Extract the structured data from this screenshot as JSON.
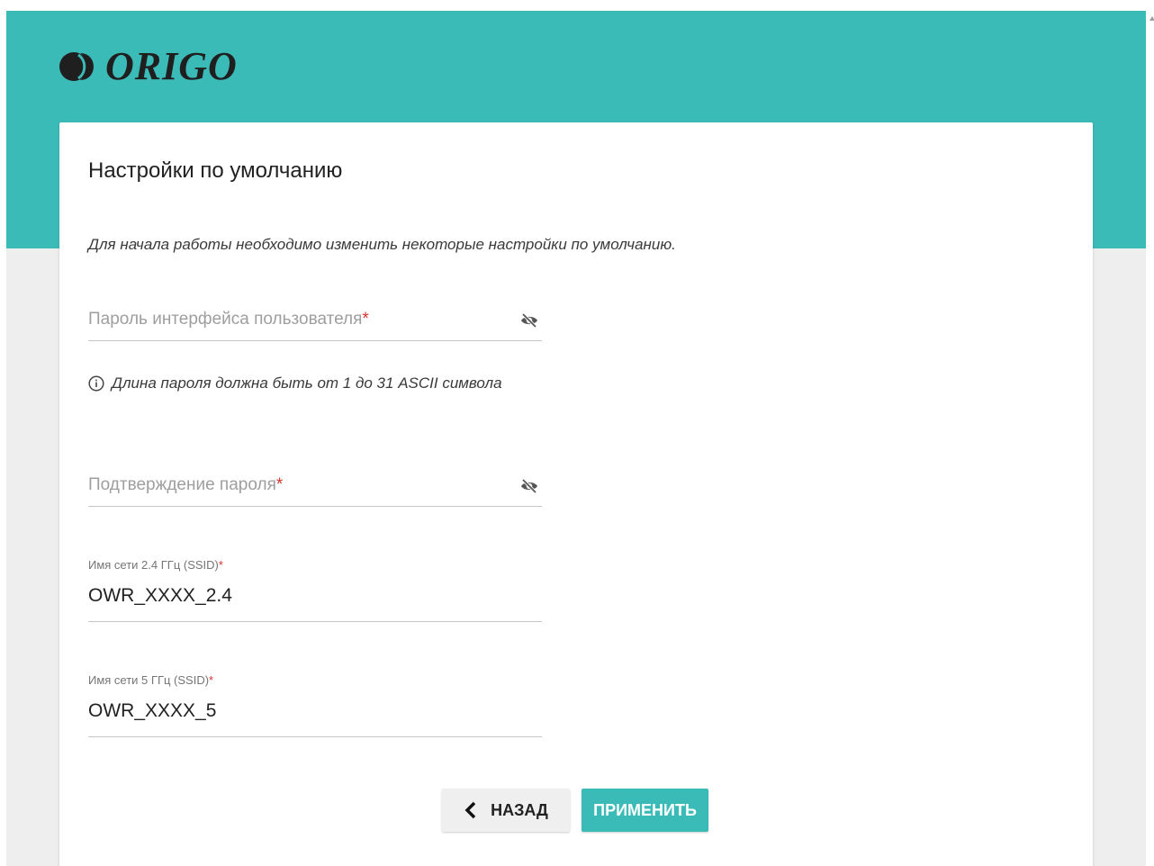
{
  "brand": {
    "name": "ORIGO"
  },
  "card": {
    "title": "Настройки по умолчанию",
    "description": "Для начала работы необходимо изменить некоторые настройки по умолчанию."
  },
  "fields": {
    "password": {
      "placeholder": "Пароль интерфейса пользователя",
      "required_mark": "*",
      "value": ""
    },
    "password_hint": "Длина пароля должна быть от 1 до 31 ASCII символа",
    "confirm": {
      "placeholder": "Подтверждение пароля",
      "required_mark": "*",
      "value": ""
    },
    "ssid_24": {
      "label": "Имя сети 2.4 ГГц (SSID)",
      "required_mark": "*",
      "value": "OWR_XXXX_2.4"
    },
    "ssid_5": {
      "label": "Имя сети 5 ГГц (SSID)",
      "required_mark": "*",
      "value": "OWR_XXXX_5"
    }
  },
  "buttons": {
    "back_label": "НАЗАД",
    "apply_label": "ПРИМЕНИТЬ"
  },
  "colors": {
    "accent": "#3bbbb8",
    "required": "#d9342b",
    "background": "#eeeeee"
  },
  "icons": {
    "logo": "origo-logo-mark",
    "password_toggle": "eye-off-icon",
    "hint": "info-icon",
    "back": "chevron-left-icon"
  }
}
